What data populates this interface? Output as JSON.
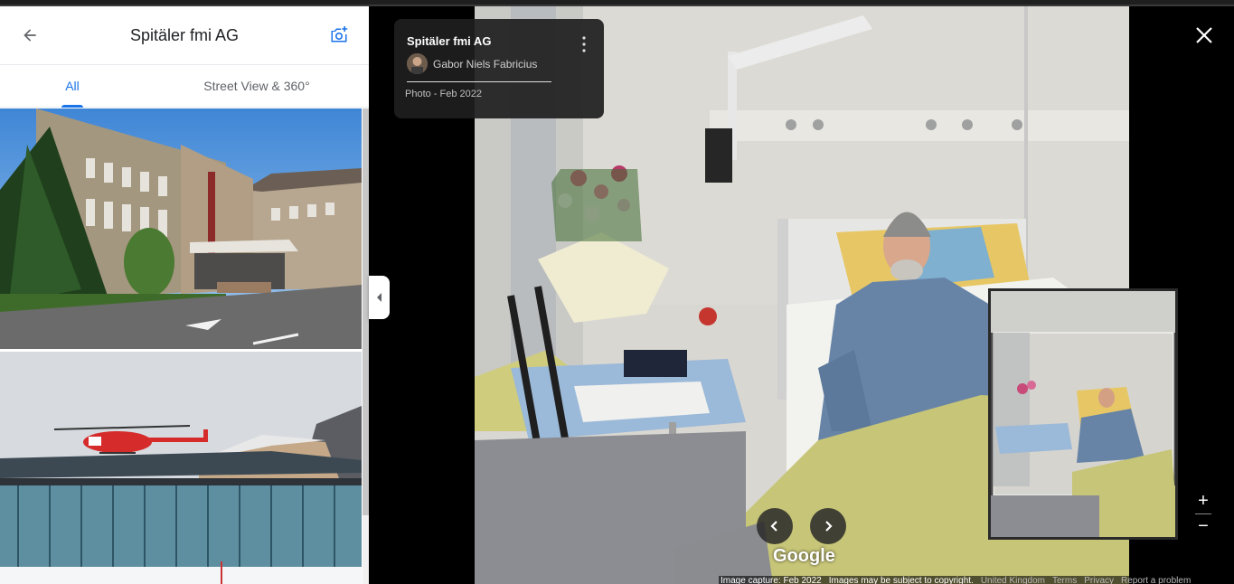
{
  "panel": {
    "title": "Spitäler fmi AG",
    "tabs": [
      {
        "label": "All",
        "active": true
      },
      {
        "label": "Street View & 360°",
        "active": false
      }
    ]
  },
  "photo_card": {
    "title": "Spitäler fmi AG",
    "author": "Gabor Niels Fabricius",
    "date": "Photo - Feb 2022"
  },
  "map": {
    "logo": "Google",
    "zoom_in": "+",
    "zoom_out": "−"
  },
  "footer": {
    "capture": "Image capture: Feb 2022",
    "copyright": "Images may be subject to copyright.",
    "region": "United Kingdom",
    "terms": "Terms",
    "privacy": "Privacy",
    "report": "Report a problem"
  },
  "icons": {
    "back": "arrow-left-icon",
    "camera": "add-photo-icon",
    "close": "close-icon",
    "more": "more-vert-icon",
    "prev": "chevron-left-icon",
    "next": "chevron-right-icon",
    "collapse": "caret-left-icon"
  },
  "colors": {
    "accent": "#1a73e8",
    "panel_bg": "#ffffff",
    "viewer_bg": "#000000"
  }
}
